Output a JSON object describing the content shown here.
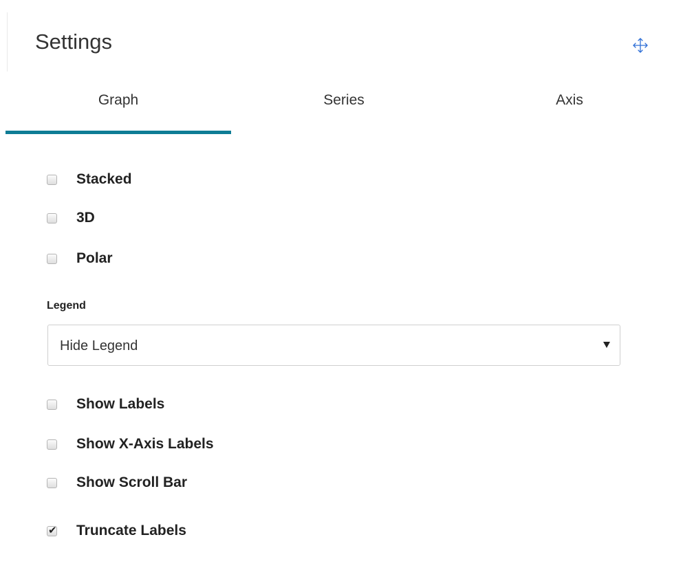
{
  "panel": {
    "title": "Settings",
    "move_icon": "move-icon"
  },
  "tabs": [
    {
      "label": "Graph",
      "active": true
    },
    {
      "label": "Series",
      "active": false
    },
    {
      "label": "Axis",
      "active": false
    }
  ],
  "colors": {
    "accent": "#0e7c95"
  },
  "options_top": [
    {
      "label": "Stacked",
      "checked": false
    },
    {
      "label": "3D",
      "checked": false
    },
    {
      "label": "Polar",
      "checked": false
    }
  ],
  "legend": {
    "label": "Legend",
    "selected": "Hide Legend"
  },
  "options_bottom": [
    {
      "label": "Show Labels",
      "checked": false
    },
    {
      "label": "Show X-Axis Labels",
      "checked": false
    },
    {
      "label": "Show Scroll Bar",
      "checked": false
    },
    {
      "label": "Truncate Labels",
      "checked": true
    }
  ]
}
